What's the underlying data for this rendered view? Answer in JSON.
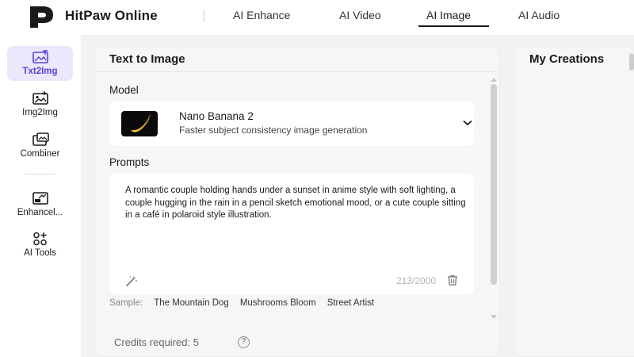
{
  "header": {
    "brand": "HitPaw Online",
    "nav": [
      "AI Enhance",
      "AI Video",
      "AI Image",
      "AI Audio"
    ],
    "active_nav": "AI Image"
  },
  "sidebar": {
    "items": [
      {
        "label": "Txt2Img",
        "icon": "text-image-icon",
        "active": true
      },
      {
        "label": "Img2Img",
        "icon": "image-image-icon",
        "active": false
      },
      {
        "label": "Combiner",
        "icon": "combine-icon",
        "active": false
      },
      {
        "label": "Enhancel...",
        "icon": "hd-enhance-icon",
        "active": false
      },
      {
        "label": "AI Tools",
        "icon": "tools-grid-icon",
        "active": false
      }
    ]
  },
  "panel": {
    "title": "Text to Image",
    "model_label": "Model",
    "model": {
      "name": "Nano Banana 2",
      "description": "Faster subject consistency image generation"
    },
    "prompts_label": "Prompts",
    "prompt_text": "A romantic couple holding hands under a sunset in anime style with soft lighting, a couple hugging in the rain in a pencil sketch emotional mood, or a cute couple sitting in a café in polaroid style illustration.",
    "counter": "213/2000",
    "sample_label": "Sample:",
    "samples": [
      "The Mountain Dog",
      "Mushrooms Bloom",
      "Street Artist"
    ],
    "credits": "Credits required: 5",
    "help_glyph": "?"
  },
  "creations": {
    "title": "My Creations"
  },
  "colors": {
    "accent": "#5a3fd6",
    "active_bg": "#ece8fb"
  }
}
